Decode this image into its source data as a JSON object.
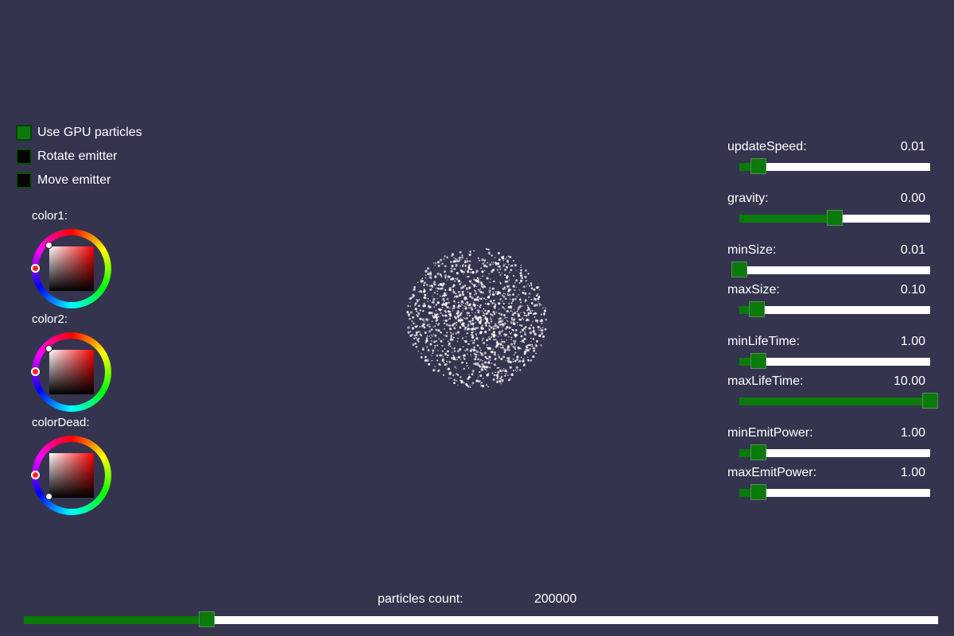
{
  "checkboxes": [
    {
      "label": "Use GPU particles",
      "checked": true
    },
    {
      "label": "Rotate emitter",
      "checked": false
    },
    {
      "label": "Move emitter",
      "checked": false
    }
  ],
  "colors": [
    {
      "label": "color1:"
    },
    {
      "label": "color2:"
    },
    {
      "label": "colorDead:"
    }
  ],
  "sliders": [
    {
      "label": "updateSpeed:",
      "value": "0.01",
      "fraction": 0.1
    },
    {
      "label": "gravity:",
      "value": "0.00",
      "fraction": 0.5
    },
    {
      "label": "minSize:",
      "value": "0.01",
      "fraction": 0.0
    },
    {
      "label": "maxSize:",
      "value": "0.10",
      "fraction": 0.09
    },
    {
      "label": "minLifeTime:",
      "value": "1.00",
      "fraction": 0.1
    },
    {
      "label": "maxLifeTime:",
      "value": "10.00",
      "fraction": 1.0
    },
    {
      "label": "minEmitPower:",
      "value": "1.00",
      "fraction": 0.1
    },
    {
      "label": "maxEmitPower:",
      "value": "1.00",
      "fraction": 0.1
    }
  ],
  "particles_count": {
    "label": "particles count:",
    "value": "200000",
    "fraction": 0.2
  },
  "colors_theme": {
    "background": "#35344f",
    "accent": "#0a7a0a",
    "track": "#ffffff"
  }
}
